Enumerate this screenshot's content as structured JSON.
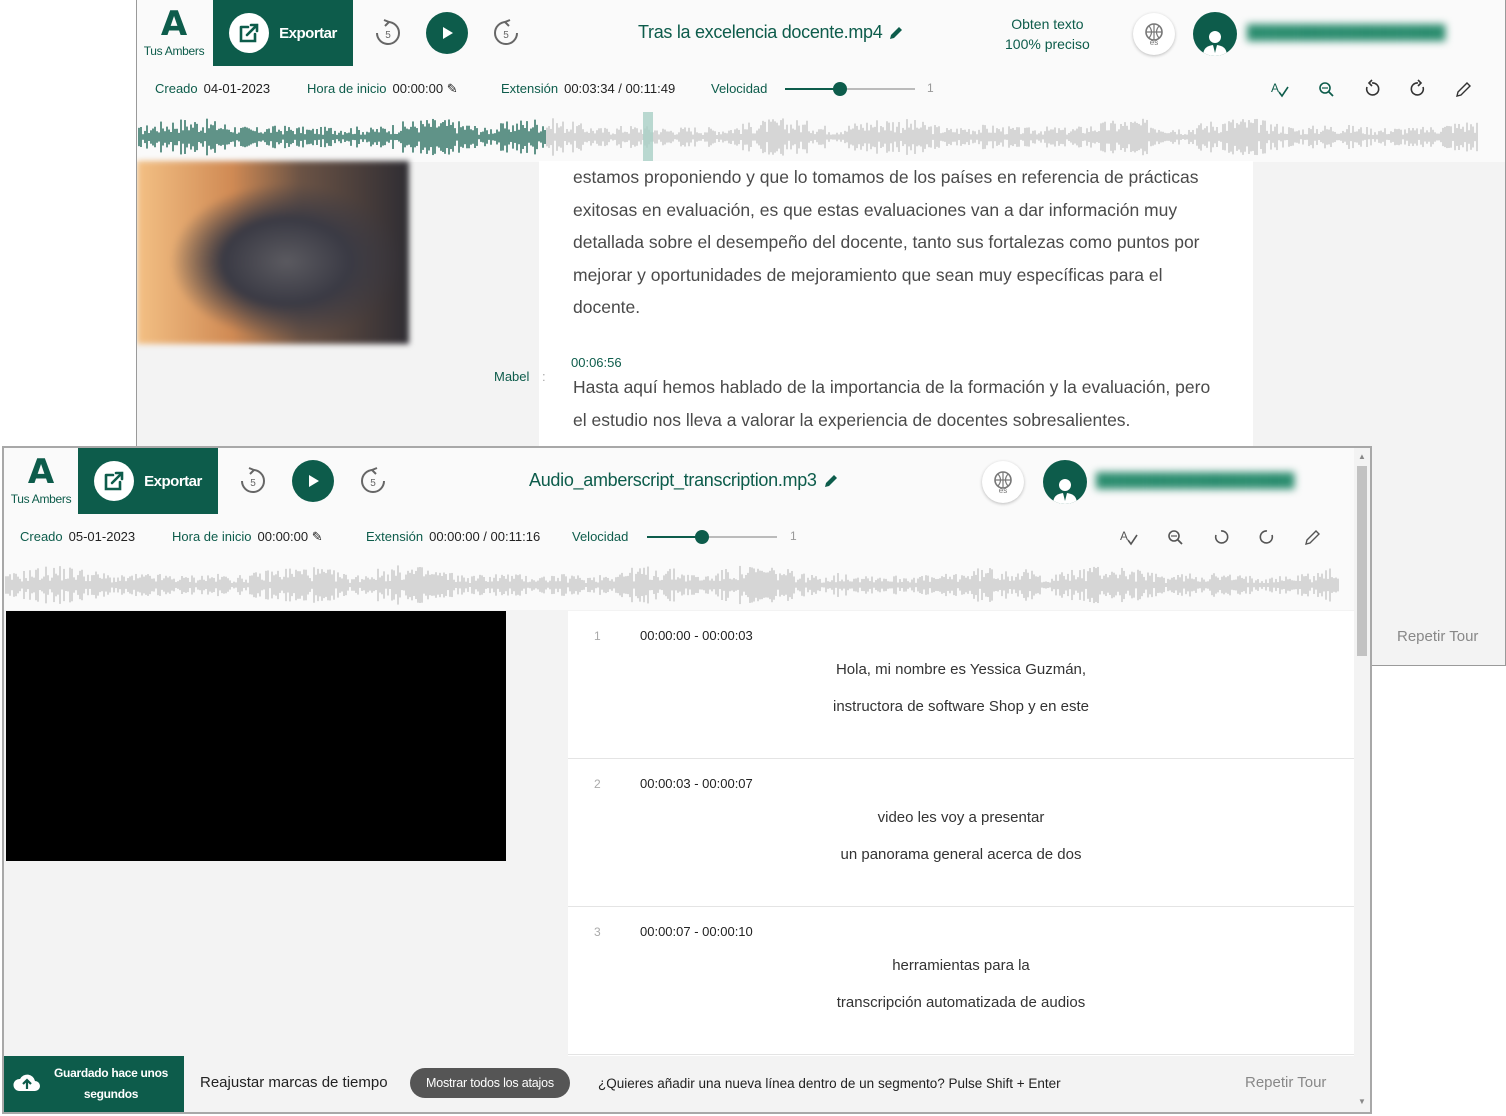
{
  "back_window": {
    "brand_label": "Tus Ambers",
    "export_label": "Exportar",
    "skip_label": "5",
    "file_name": "Tras la excelencia docente.mp4",
    "promo_line1": "Obten texto",
    "promo_line2": "100% preciso",
    "language": "es",
    "info": {
      "created_label": "Creado",
      "created_value": "04-01-2023",
      "start_label": "Hora de inicio",
      "start_value": "00:00:00",
      "length_label": "Extensión",
      "length_value": "00:03:34 / 00:11:49",
      "speed_label": "Velocidad",
      "speed_value": "1"
    },
    "paragraph1": [
      "estamos proponiendo y que lo tomamos de los países en referencia de prácticas",
      "exitosas en evaluación, es que estas evaluaciones van a dar información muy",
      "detallada sobre el desempeño del docente, tanto sus fortalezas como puntos por",
      "mejorar y oportunidades de mejoramiento que sean muy específicas para el",
      "docente."
    ],
    "timestamp2": "00:06:56",
    "speaker2": "Mabel",
    "speaker_sep": ":",
    "paragraph2": [
      "Hasta aquí hemos hablado de la importancia de la formación y la evaluación, pero",
      "el estudio nos lleva a valorar la experiencia de docentes sobresalientes."
    ],
    "repeat_tour": "Repetir Tour"
  },
  "front_window": {
    "brand_label": "Tus Ambers",
    "export_label": "Exportar",
    "skip_label": "5",
    "file_name": "Audio_amberscript_transcription.mp3",
    "language": "es",
    "info": {
      "created_label": "Creado",
      "created_value": "05-01-2023",
      "start_label": "Hora de inicio",
      "start_value": "00:00:00",
      "length_label": "Extensión",
      "length_value": "00:00:00 / 00:11:16",
      "speed_label": "Velocidad",
      "speed_value": "1"
    },
    "segments": [
      {
        "num": "1",
        "time": "00:00:00 - 00:00:03",
        "line1": "Hola, mi nombre es Yessica Guzmán,",
        "line2": "instructora de software Shop y en este"
      },
      {
        "num": "2",
        "time": "00:00:03 - 00:00:07",
        "line1": "video les voy a presentar",
        "line2": "un panorama general acerca de dos"
      },
      {
        "num": "3",
        "time": "00:00:07 - 00:00:10",
        "line1": "herramientas para la",
        "line2": "transcripción automatizada de audios"
      }
    ],
    "bottom": {
      "saved_label": "Guardado hace unos segundos",
      "readjust_label": "Reajustar marcas de tiempo",
      "shortcuts_label": "Mostrar todos los atajos",
      "tip": "¿Quieres añadir una nueva línea dentro de un segmento? Pulse Shift + Enter",
      "repeat_tour": "Repetir Tour"
    }
  },
  "colors": {
    "brand": "#0d5c4b",
    "wave_played": "#0d5c4b",
    "wave_unplayed": "#c4c4c4"
  }
}
